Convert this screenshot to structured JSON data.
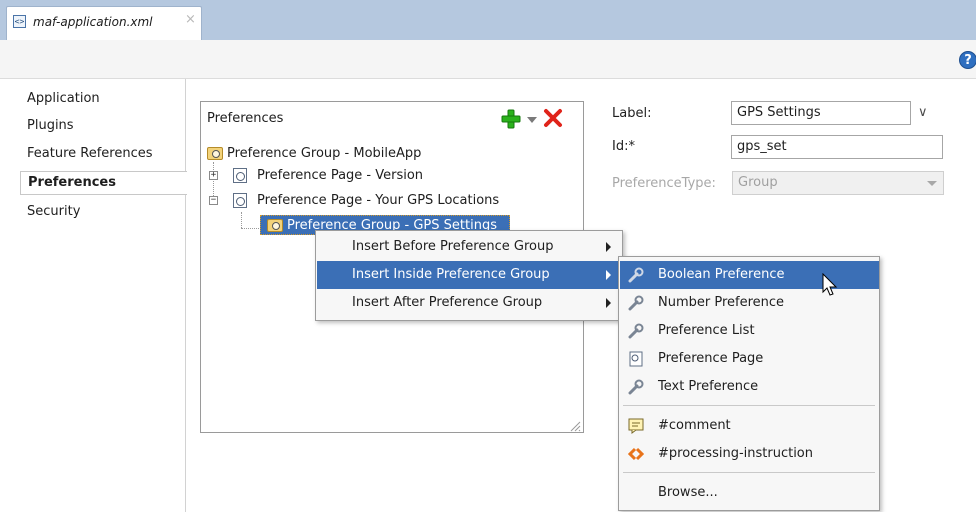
{
  "editor_tab": {
    "title": "maf-application.xml",
    "close_glyph": "×",
    "file_icon": "<>"
  },
  "toolbar": {
    "help_glyph": "?"
  },
  "left_nav": {
    "items": [
      "Application",
      "Plugins",
      "Feature References",
      "Preferences",
      "Security"
    ],
    "selected": "Preferences"
  },
  "preferences_panel": {
    "title": "Preferences",
    "tree": [
      {
        "label": "Preference Group - MobileApp"
      },
      {
        "label": "Preference Page - Version",
        "expander": "+"
      },
      {
        "label": "Preference Page - Your GPS Locations",
        "expander": "−"
      },
      {
        "label": "Preference Group - GPS Settings",
        "selected": true
      }
    ]
  },
  "properties": {
    "label": {
      "label": "Label:",
      "value": "GPS Settings",
      "dropdown_glyph": "∨"
    },
    "id": {
      "label": "Id:*",
      "value": "gps_set"
    },
    "preference_type": {
      "label": "PreferenceType:",
      "value": "Group",
      "disabled": true
    }
  },
  "context_menu": {
    "items": [
      {
        "label": "Insert Before Preference Group",
        "mnemonic": "B"
      },
      {
        "label": "Insert Inside Preference Group",
        "mnemonic": "I",
        "highlighted": true
      },
      {
        "label": "Insert After Preference Group",
        "mnemonic": "A"
      }
    ]
  },
  "submenu": {
    "items": [
      {
        "label": "Boolean Preference",
        "icon": "wrench-icon",
        "highlighted": true
      },
      {
        "label": "Number Preference",
        "icon": "wrench-icon"
      },
      {
        "label": "Preference List",
        "icon": "wrench-icon"
      },
      {
        "label": "Preference Page",
        "icon": "page-icon"
      },
      {
        "label": "Text Preference",
        "icon": "wrench-icon"
      },
      {
        "label": "#comment",
        "icon": "comment-icon"
      },
      {
        "label": "#processing-instruction",
        "icon": "processing-instruction-icon"
      },
      {
        "label": "Browse..."
      }
    ]
  },
  "colors": {
    "accent": "#3b6fb6",
    "tab_strip": "#b5c8df",
    "delete": "#e0231a",
    "add": "#2bb21c"
  }
}
